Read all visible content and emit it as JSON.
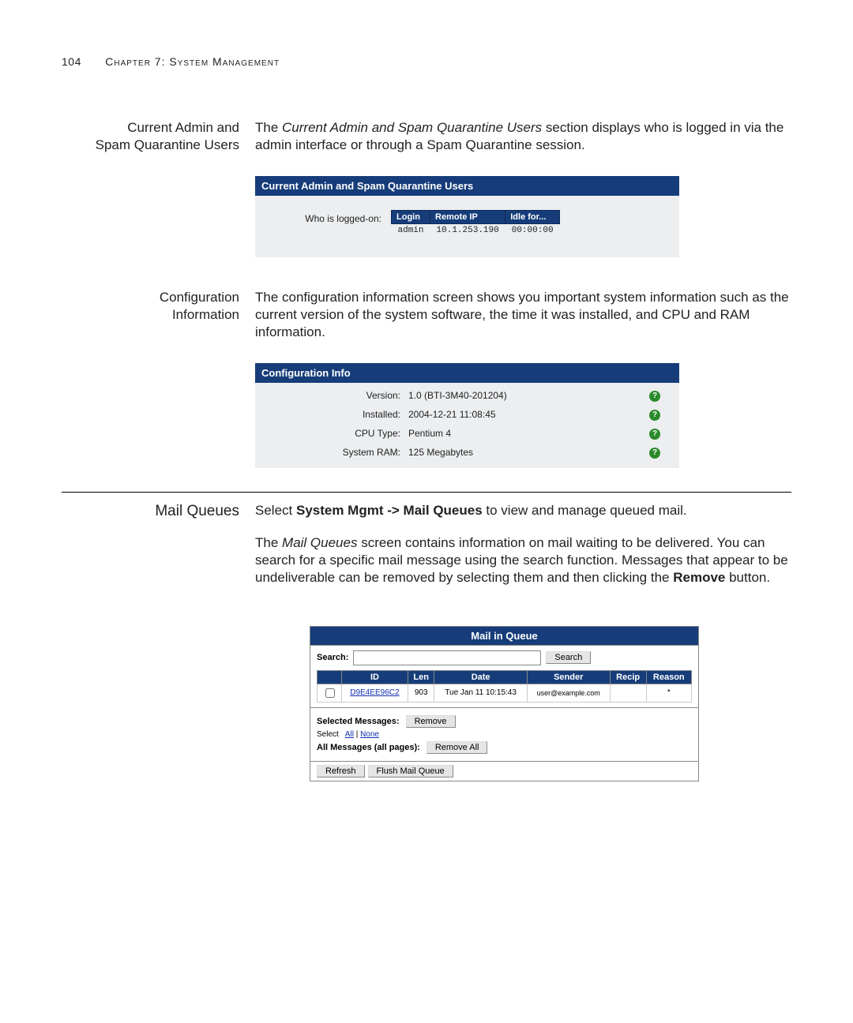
{
  "header": {
    "page_number": "104",
    "chapter": "Chapter 7: System Management"
  },
  "sec1": {
    "sidehead_l1": "Current Admin and",
    "sidehead_l2": "Spam Quarantine Users",
    "body_1a": "The ",
    "body_1b": "Current Admin and Spam Quarantine Users",
    "body_1c": " section displays who is logged in via the admin interface or through a Spam Quarantine session."
  },
  "users_panel": {
    "title": "Current Admin and Spam Quarantine Users",
    "row_label": "Who is logged-on:",
    "cols": {
      "login": "Login",
      "remote_ip": "Remote IP",
      "idle": "Idle for..."
    },
    "row": {
      "login": "admin",
      "remote_ip": "10.1.253.190",
      "idle": "00:00:00"
    }
  },
  "sec2": {
    "sidehead_l1": "Configuration",
    "sidehead_l2": "Information",
    "body": "The configuration information screen shows you important system information such as the current version of the system software, the time it was installed, and CPU and RAM information."
  },
  "config_panel": {
    "title": "Configuration Info",
    "rows": [
      {
        "label": "Version:",
        "value": "1.0 (BTI-3M40-201204)"
      },
      {
        "label": "Installed:",
        "value": "2004-12-21 11:08:45"
      },
      {
        "label": "CPU Type:",
        "value": "Pentium 4"
      },
      {
        "label": "System RAM:",
        "value": "125 Megabytes"
      }
    ],
    "help_char": "?"
  },
  "sec3": {
    "sidehead": "Mail Queues",
    "p1_a": "Select ",
    "p1_b": "System Mgmt -> Mail Queues",
    "p1_c": " to view and manage queued mail.",
    "p2_a": "The ",
    "p2_b": "Mail Queues",
    "p2_c": " screen contains information on mail waiting to be delivered. You can search for a specific mail message using the search function. Messages that appear to be undeliverable can be removed by selecting them and then clicking the ",
    "p2_d": "Remove",
    "p2_e": " button."
  },
  "mq_panel": {
    "title": "Mail in Queue",
    "search_label": "Search:",
    "search_button": "Search",
    "cols": {
      "id": "ID",
      "len": "Len",
      "date": "Date",
      "sender": "Sender",
      "recip": "Recip",
      "reason": "Reason"
    },
    "row": {
      "id": "D9E4EE96C2",
      "len": "903",
      "date": "Tue Jan 11 10:15:43",
      "sender": "user@example.com",
      "recip": "",
      "reason": "*"
    },
    "selected_label": "Selected Messages:",
    "remove_btn": "Remove",
    "select_prefix": "Select",
    "select_all": "All",
    "select_sep": " | ",
    "select_none": "None",
    "allmsg_label": "All Messages (all pages):",
    "remove_all_btn": "Remove All",
    "refresh_btn": "Refresh",
    "flush_btn": "Flush Mail Queue"
  }
}
